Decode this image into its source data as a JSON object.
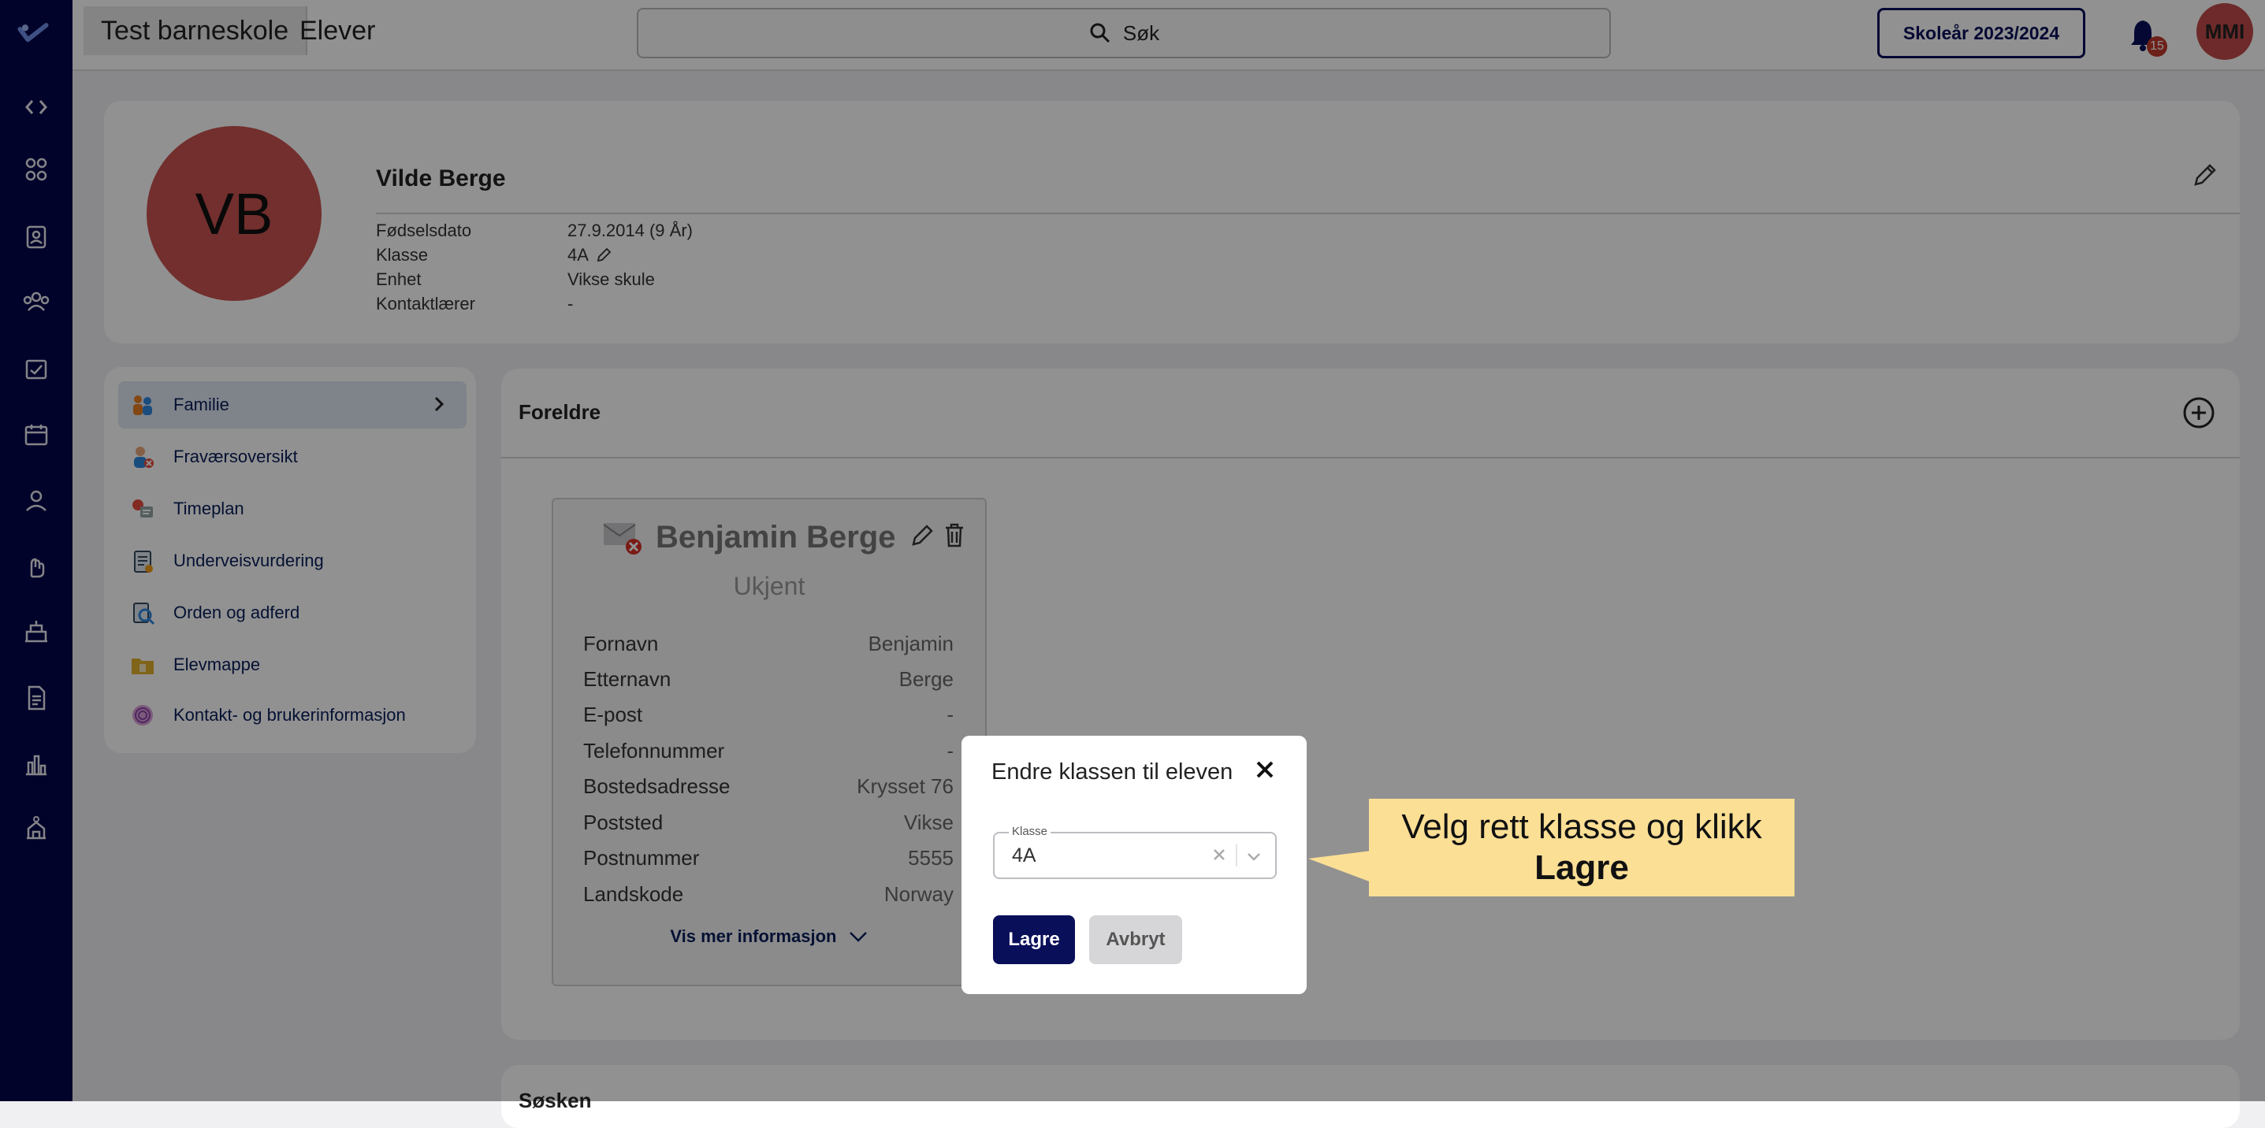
{
  "topbar": {
    "school": "Test barneskole",
    "page_title": "Elever",
    "search_placeholder": "Søk",
    "school_year": "Skoleår 2023/2024",
    "notifications_count": "15",
    "user_initials": "MMI"
  },
  "profile": {
    "initials": "VB",
    "name": "Vilde Berge",
    "fields": [
      {
        "label": "Fødselsdato",
        "value": "27.9.2014 (9 År)"
      },
      {
        "label": "Klasse",
        "value": "4A"
      },
      {
        "label": "Enhet",
        "value": "Vikse skule"
      },
      {
        "label": "Kontaktlærer",
        "value": "-"
      }
    ]
  },
  "menu": {
    "items": [
      {
        "label": "Familie",
        "icon": "family-icon"
      },
      {
        "label": "Fraværsoversikt",
        "icon": "absence-icon"
      },
      {
        "label": "Timeplan",
        "icon": "schedule-icon"
      },
      {
        "label": "Underveisvurdering",
        "icon": "assessment-icon"
      },
      {
        "label": "Orden og adferd",
        "icon": "behavior-icon"
      },
      {
        "label": "Elevmappe",
        "icon": "folder-icon"
      },
      {
        "label": "Kontakt- og brukerinformasjon",
        "icon": "fingerprint-icon"
      }
    ]
  },
  "parents": {
    "title": "Foreldre",
    "card": {
      "name": "Benjamin Berge",
      "status": "Ukjent",
      "rows": [
        {
          "k": "Fornavn",
          "v": "Benjamin"
        },
        {
          "k": "Etternavn",
          "v": "Berge"
        },
        {
          "k": "E-post",
          "v": "-"
        },
        {
          "k": "Telefonnummer",
          "v": "-"
        },
        {
          "k": "Bostedsadresse",
          "v": "Krysset 76"
        },
        {
          "k": "Poststed",
          "v": "Vikse"
        },
        {
          "k": "Postnummer",
          "v": "5555"
        },
        {
          "k": "Landskode",
          "v": "Norway"
        }
      ],
      "more": "Vis mer informasjon"
    }
  },
  "siblings": {
    "title": "Søsken"
  },
  "modal": {
    "title": "Endre klassen til eleven",
    "select_label": "Klasse",
    "select_value": "4A",
    "save": "Lagre",
    "cancel": "Avbryt"
  },
  "callout": {
    "line1": "Velg rett klasse og klikk",
    "line2": "Lagre"
  }
}
